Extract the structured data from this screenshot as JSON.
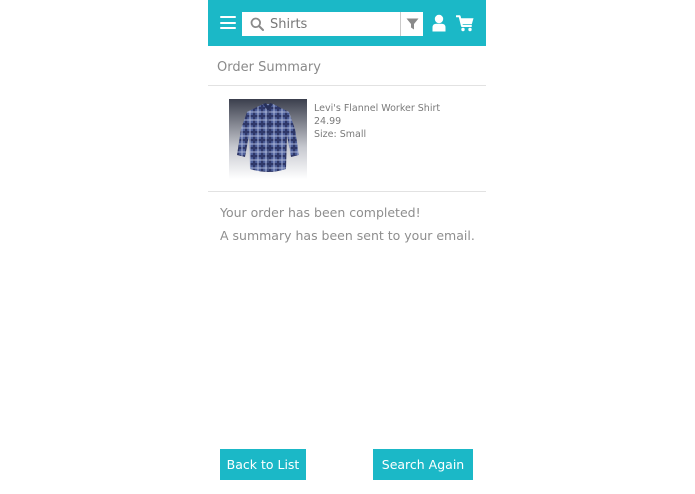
{
  "header": {
    "menu_icon": "hamburger-menu-icon",
    "search": {
      "value": "Shirts",
      "icon": "search-icon"
    },
    "filter_icon": "filter-icon",
    "user_icon": "user-icon",
    "cart_icon": "shopping-cart-icon"
  },
  "order": {
    "title": "Order Summary",
    "item": {
      "name": "Levi's Flannel Worker Shirt",
      "price": "24.99",
      "size": "Size: Small"
    },
    "message_line1": "Your order has been completed!",
    "message_line2": "A summary has been sent to your email."
  },
  "actions": {
    "back_label": "Back to List",
    "search_again_label": "Search Again"
  },
  "colors": {
    "accent": "#1bb8c7",
    "text": "#8a8a8a",
    "divider": "#e2e2e2"
  }
}
